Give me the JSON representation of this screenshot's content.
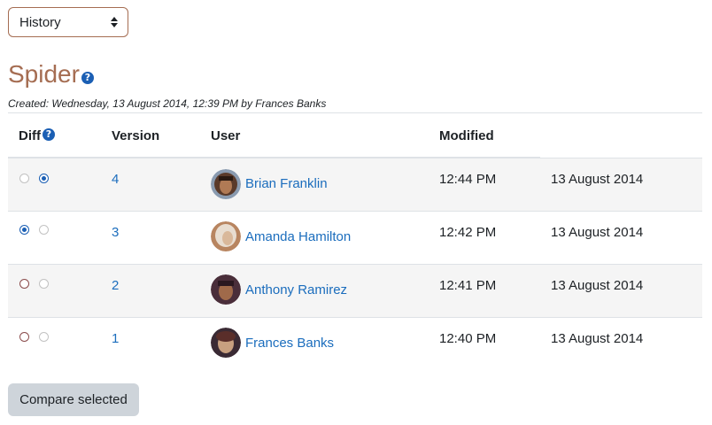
{
  "history_select": {
    "selected": "History"
  },
  "page": {
    "title": "Spider",
    "help_glyph": "?",
    "created": "Created: Wednesday, 13 August 2014, 12:39 PM by Frances Banks"
  },
  "table": {
    "headers": {
      "diff": "Diff",
      "version": "Version",
      "user": "User",
      "modified": "Modified"
    },
    "rows": [
      {
        "version": "4",
        "user": "Brian Franklin",
        "time": "12:44 PM",
        "date": "13 August 2014",
        "diff_left_checked": false,
        "diff_right_checked": true
      },
      {
        "version": "3",
        "user": "Amanda Hamilton",
        "time": "12:42 PM",
        "date": "13 August 2014",
        "diff_left_checked": true,
        "diff_right_checked": false
      },
      {
        "version": "2",
        "user": "Anthony Ramirez",
        "time": "12:41 PM",
        "date": "13 August 2014",
        "diff_left_checked": false,
        "diff_right_checked": false
      },
      {
        "version": "1",
        "user": "Frances Banks",
        "time": "12:40 PM",
        "date": "13 August 2014",
        "diff_left_checked": false,
        "diff_right_checked": false
      }
    ]
  },
  "actions": {
    "compare_label": "Compare selected"
  },
  "colors": {
    "title": "#a56d52",
    "link": "#1b6dbd",
    "accent": "#1b5fb4",
    "button_bg": "#ced4da"
  }
}
